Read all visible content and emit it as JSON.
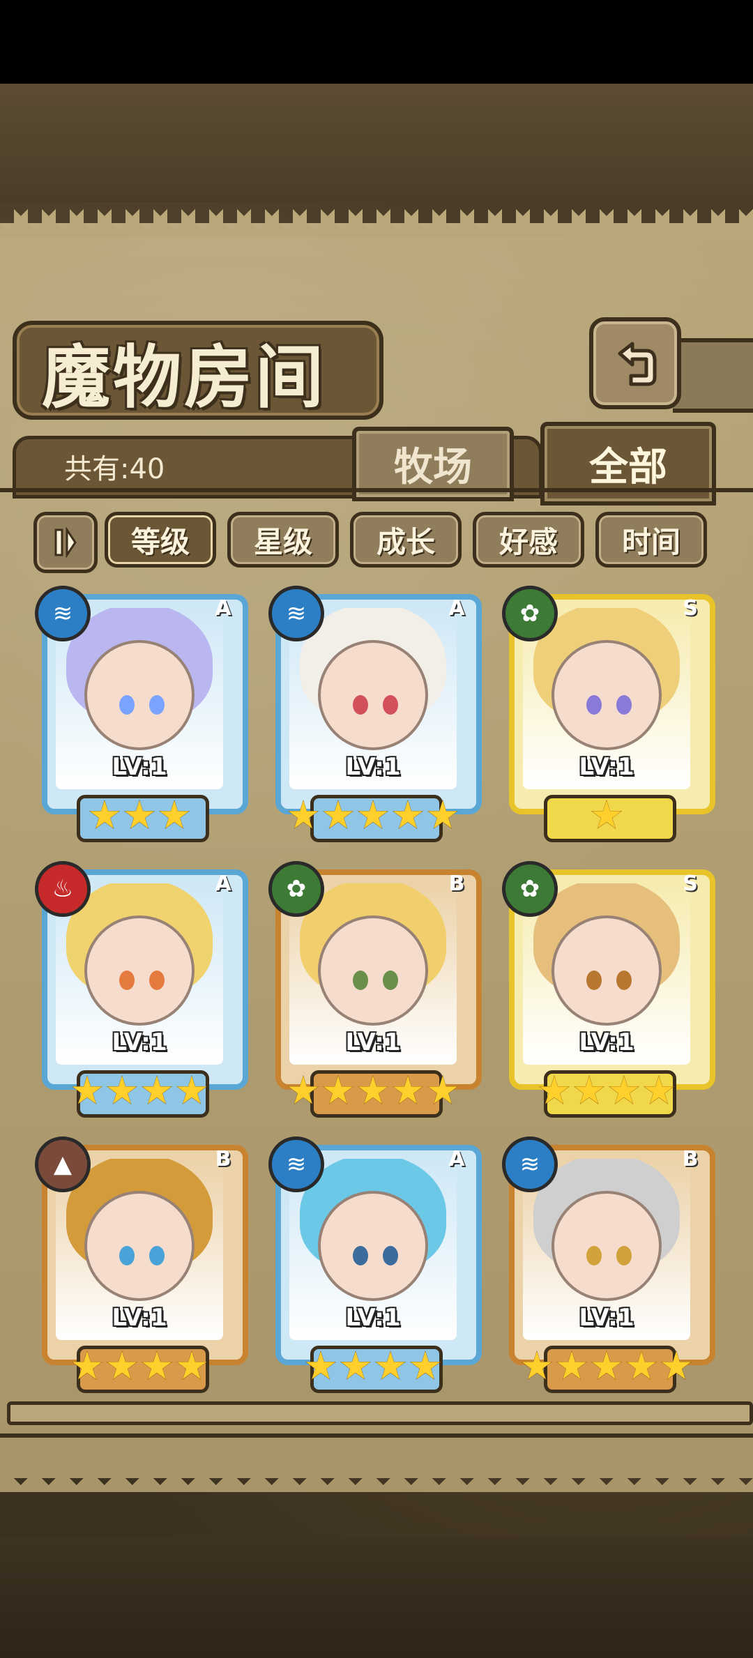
{
  "screen": {
    "title": "魔物房间",
    "count_label": "共有:40"
  },
  "tabs": [
    {
      "label": "牧场",
      "active": false
    },
    {
      "label": "全部",
      "active": true
    }
  ],
  "filters": [
    {
      "label": "等级",
      "active": true
    },
    {
      "label": "星级",
      "active": false
    },
    {
      "label": "成长",
      "active": false
    },
    {
      "label": "好感",
      "active": false
    },
    {
      "label": "时间",
      "active": false
    }
  ],
  "icons": {
    "back": "back-arrow-icon",
    "filter_toggle": "pause-bars-icon"
  },
  "colors": {
    "water": "#2c7fc4",
    "fire": "#c62a2a",
    "nature": "#3d7a35",
    "earth": "#7a4a3a",
    "frame_blue": "#5aa7d6",
    "frame_gold": "#e8c42a",
    "frame_bronze": "#c7832f"
  },
  "monsters": [
    {
      "level": "LV:1",
      "rank": "A",
      "element": "water",
      "stars": 3,
      "frame": "blue",
      "hair": "#b9b6f0",
      "eyes": "#7aa2ff"
    },
    {
      "level": "LV:1",
      "rank": "A",
      "element": "water",
      "stars": 5,
      "frame": "blue",
      "hair": "#f2eee8",
      "eyes": "#d1505c"
    },
    {
      "level": "LV:1",
      "rank": "S",
      "element": "nature",
      "stars": 1,
      "frame": "gold",
      "hair": "#f0cf7a",
      "eyes": "#8a7ad8"
    },
    {
      "level": "LV:1",
      "rank": "A",
      "element": "fire",
      "stars": 4,
      "frame": "blue",
      "hair": "#f0d36f",
      "eyes": "#e57a3f"
    },
    {
      "level": "LV:1",
      "rank": "B",
      "element": "nature",
      "stars": 5,
      "frame": "bronze",
      "hair": "#f2cf6d",
      "eyes": "#6a8f4a"
    },
    {
      "level": "LV:1",
      "rank": "S",
      "element": "nature",
      "stars": 4,
      "frame": "gold",
      "hair": "#e6bf7c",
      "eyes": "#b8772f"
    },
    {
      "level": "LV:1",
      "rank": "B",
      "element": "earth",
      "stars": 4,
      "frame": "bronze",
      "hair": "#d39b3a",
      "eyes": "#4aa3d8"
    },
    {
      "level": "LV:1",
      "rank": "A",
      "element": "water",
      "stars": 4,
      "frame": "blue",
      "hair": "#6bc8e6",
      "eyes": "#3c6c9c"
    },
    {
      "level": "LV:1",
      "rank": "B",
      "element": "water",
      "stars": 5,
      "frame": "bronze",
      "hair": "#cfcfcf",
      "eyes": "#d1a13a"
    }
  ]
}
